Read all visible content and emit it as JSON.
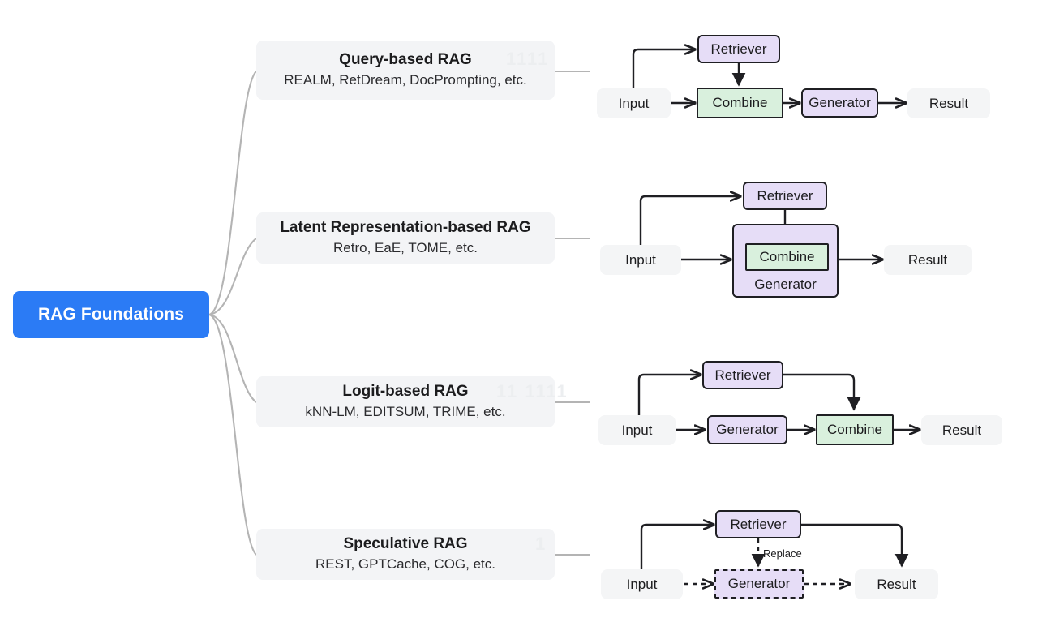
{
  "root": {
    "label": "RAG Foundations",
    "color": "#2b7bf5"
  },
  "palette": {
    "retriever_fill": "#e6ddf7",
    "generator_fill": "#e6ddf7",
    "combine_fill": "#d9f0dd",
    "io_fill": "#f4f5f6",
    "card_fill": "#f3f4f6",
    "stroke": "#1f1f23",
    "connector": "#b4b4b4"
  },
  "branches": [
    {
      "title": "Query-based RAG",
      "subtitle": "REALM, RetDream, DocPrompting, etc.",
      "watermark": "1111",
      "flow": {
        "input": "Input",
        "retriever": "Retriever",
        "combine": "Combine",
        "generator": "Generator",
        "result": "Result"
      }
    },
    {
      "title": "Latent Representation-based RAG",
      "subtitle": "Retro, EaE, TOME, etc.",
      "watermark": "",
      "flow": {
        "input": "Input",
        "retriever": "Retriever",
        "combine": "Combine",
        "generator": "Generator",
        "result": "Result"
      }
    },
    {
      "title": "Logit-based RAG",
      "subtitle": "kNN-LM, EDITSUM, TRIME, etc.",
      "watermark": "11 1111",
      "flow": {
        "input": "Input",
        "retriever": "Retriever",
        "generator": "Generator",
        "combine": "Combine",
        "result": "Result"
      }
    },
    {
      "title": "Speculative RAG",
      "subtitle": "REST, GPTCache, COG, etc.",
      "watermark": "1",
      "flow": {
        "input": "Input",
        "retriever": "Retriever",
        "generator": "Generator",
        "result": "Result",
        "edge_label": "Replace"
      }
    }
  ]
}
